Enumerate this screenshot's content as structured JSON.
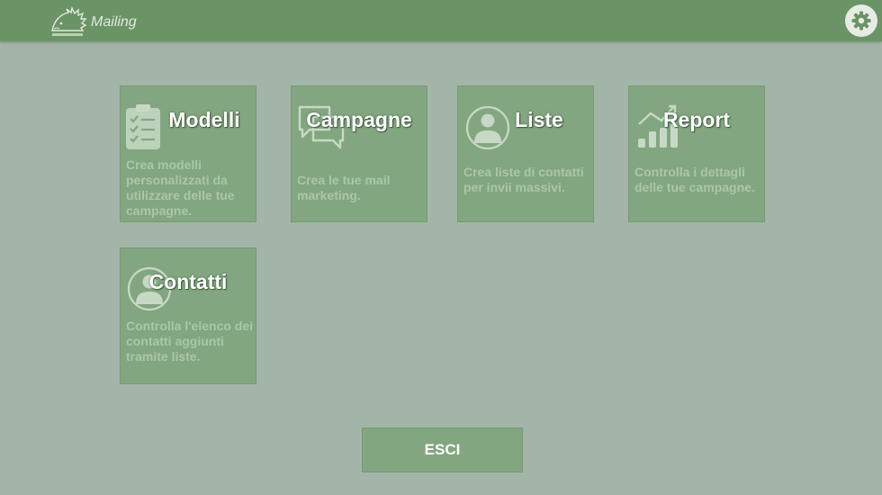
{
  "header": {
    "app_title": "Mailing",
    "logo_icon": "hedgehog-logo-icon",
    "settings_icon": "gear-icon"
  },
  "cards": [
    {
      "id": "modelli",
      "title": "Modelli",
      "description": "Crea modelli personalizzati da utilizzare delle tue campagne.",
      "icon": "clipboard-checklist-icon"
    },
    {
      "id": "campagne",
      "title": "Campagne",
      "description": "Crea le tue mail marketing.",
      "icon": "chat-bubbles-icon"
    },
    {
      "id": "liste",
      "title": "Liste",
      "description": "Crea liste di contatti per invii massivi.",
      "icon": "user-circle-icon"
    },
    {
      "id": "report",
      "title": "Report",
      "description": "Controlla i dettagli delle tue campagne.",
      "icon": "bar-chart-icon"
    },
    {
      "id": "contatti",
      "title": "Contatti",
      "description": "Controlla l'elenco dei contatti aggiunti tramite liste.",
      "icon": "user-circle-icon"
    }
  ],
  "exit_button": {
    "label": "ESCI"
  },
  "colors": {
    "header": "#6b9466",
    "background": "#a3b5a8",
    "card": "#82a67f",
    "card_text": "#a9c8a6",
    "title_text": "#ffffff"
  }
}
